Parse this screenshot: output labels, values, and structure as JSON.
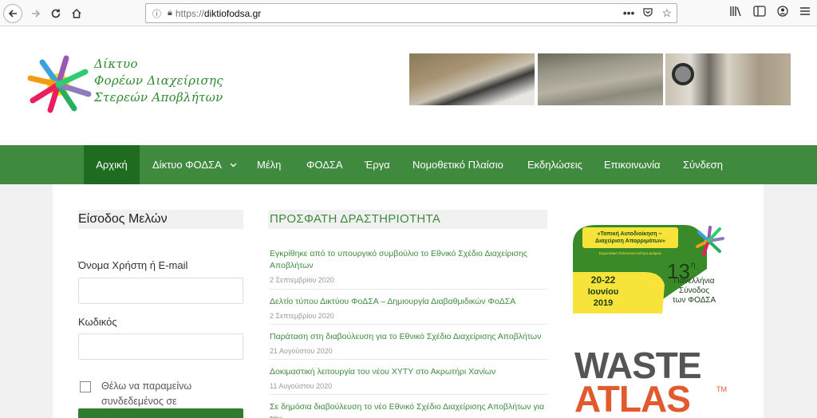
{
  "browser": {
    "url_protocol": "https://",
    "url_host": "diktiofodsa.gr"
  },
  "site": {
    "logo_lines": [
      "Δίκτυο",
      "Φορέων Διαχείρισης",
      "Στερεών Αποβλήτων"
    ]
  },
  "nav": {
    "items": [
      {
        "label": "Αρχική",
        "active": true
      },
      {
        "label": "Δίκτυο ΦΟΔΣΑ",
        "dropdown": true
      },
      {
        "label": "Μέλη"
      },
      {
        "label": "ΦΟΔΣΑ"
      },
      {
        "label": "Έργα"
      },
      {
        "label": "Νομοθετικό Πλαίσιο"
      },
      {
        "label": "Εκδηλώσεις"
      },
      {
        "label": "Επικοινωνία"
      },
      {
        "label": "Σύνδεση"
      }
    ]
  },
  "login": {
    "title": "Είσοδος Μελών",
    "username_label": "Όνομα Χρήστη ή E-mail",
    "password_label": "Κωδικός",
    "remember_label": "Θέλω να παραμείνω συνδεδεμένος σε"
  },
  "activity": {
    "title": "ΠΡΟΣΦΑΤΗ ΔΡΑΣΤΗΡΙΟΤΗΤΑ",
    "posts": [
      {
        "title": "Εγκρίθηκε από το υπουργικό συμβούλιο το Εθνικό Σχέδιο Διαχείρισης Αποβλήτων",
        "date": "2 Σεπτεμβρίου 2020"
      },
      {
        "title": "Δελτίο τύπου Δικτύου ΦοΔΣΑ – Δημιουργία Διαβαθμιδικών ΦοΔΣΑ",
        "date": "2 Σεπτεμβρίου 2020"
      },
      {
        "title": "Παράταση στη διαβούλευση για το Εθνικό Σχέδιο Διαχείρισης Αποβλήτων",
        "date": "21 Αυγούστου 2020"
      },
      {
        "title": "Δοκιμαστική λειτουργία του νέου ΧΥΤΥ στο Ακρωτήρι Χανίων",
        "date": "11 Αυγούστου 2020"
      },
      {
        "title": "Σε δημόσια διαβούλευση το νέο Εθνικό Σχέδιο Διαχείρισης Αποβλήτων για την",
        "date": ""
      }
    ]
  },
  "event_banner": {
    "headline": "«Τοπική Αυτοδιοίκηση – Διαχείριση Απορριμάτων»",
    "venue": "Ευρωπαϊκό Πολιτιστικό Κέντρο Δελφών",
    "dates": "20-22",
    "month": "Ιουνίου",
    "year": "2019",
    "number": "13",
    "suffix": "η",
    "line1": "Πανελλήνια",
    "line2": "Σύνοδος",
    "line3": "των ΦΟΔΣΑ"
  },
  "waste_atlas": {
    "word1": "WASTE",
    "word2": "ATLAS",
    "tm": "TM"
  },
  "colors": {
    "brand_green": "#3f8a3f",
    "active_green": "#1f6b1f",
    "atlas_orange": "#e2592e"
  }
}
